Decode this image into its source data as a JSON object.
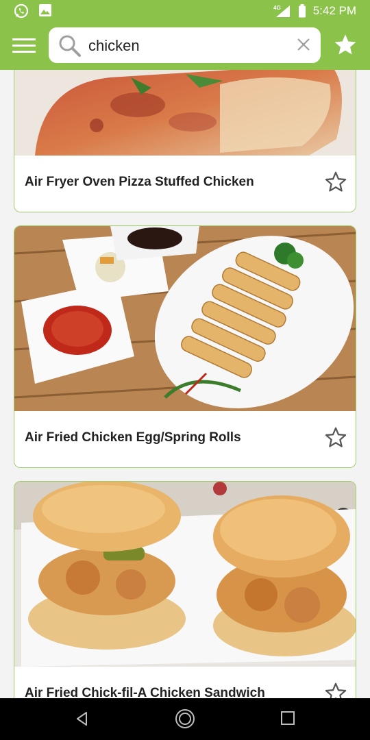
{
  "status_bar": {
    "time": "5:42 PM",
    "network": "4G",
    "icons": [
      "whatsapp-icon",
      "image-icon",
      "signal-icon",
      "battery-icon"
    ]
  },
  "app_bar": {
    "search_value": "chicken",
    "icons": [
      "menu-icon",
      "search-icon",
      "clear-icon",
      "favorites-star-icon"
    ],
    "accent": "#8bc34a"
  },
  "recipes": [
    {
      "title": "Air Fryer Oven Pizza Stuffed Chicken"
    },
    {
      "title": "Air Fried Chicken Egg/Spring Rolls"
    },
    {
      "title": "Air Fried Chick-fil-A Chicken Sandwich"
    }
  ],
  "nav_bar": {
    "icons": [
      "back-icon",
      "home-icon",
      "recents-icon"
    ]
  }
}
